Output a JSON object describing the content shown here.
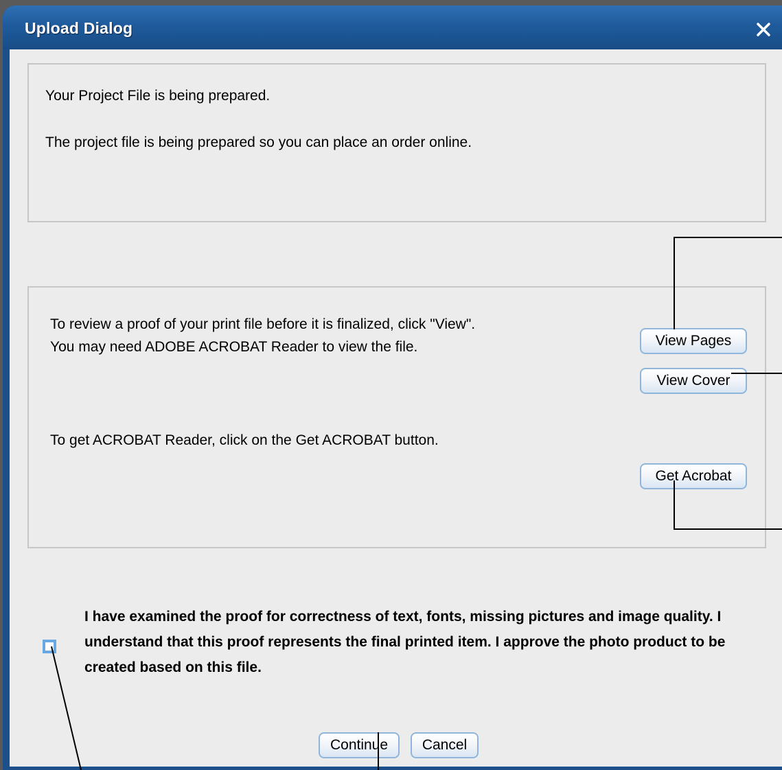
{
  "dialog": {
    "title": "Upload Dialog",
    "close_icon": "close-icon"
  },
  "status_panel": {
    "heading": "Your Project File is being prepared.",
    "message": "The project file is being prepared so you can place an order online."
  },
  "review_panel": {
    "review_line1": "To review a proof of your print file before it is finalized, click \"View\".",
    "review_line2": "You may need ADOBE ACROBAT  Reader to view the file.",
    "acrobat_text": "To get ACROBAT Reader, click on the Get ACROBAT button.",
    "view_pages_label": "View Pages",
    "view_cover_label": "View Cover",
    "get_acrobat_label": "Get Acrobat"
  },
  "approval": {
    "checked": false,
    "text": "I have examined the proof for correctness of text, fonts, missing pictures and image quality. I understand that this proof represents the final printed item. I approve the photo product to be created based on this file."
  },
  "footer": {
    "continue_label": "Continue",
    "cancel_label": "Cancel"
  },
  "colors": {
    "titlebar": "#1f5b9c",
    "client_bg": "#ececec",
    "button_border": "#8fb5db",
    "checkbox_border": "#6aa8e4"
  }
}
